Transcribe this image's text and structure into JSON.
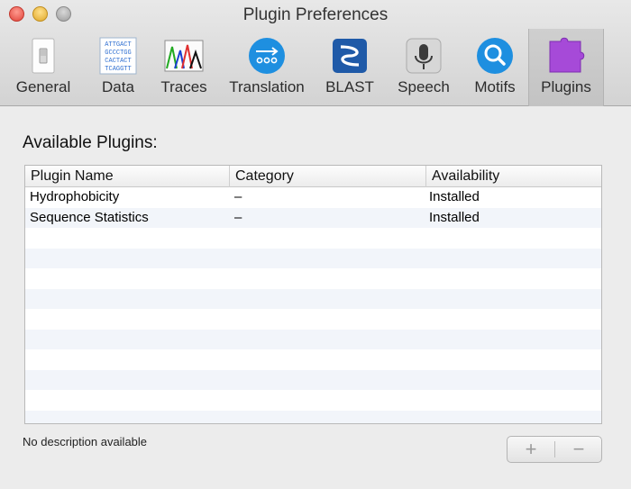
{
  "window": {
    "title": "Plugin Preferences"
  },
  "toolbar": {
    "tabs": [
      {
        "label": "General"
      },
      {
        "label": "Data"
      },
      {
        "label": "Traces"
      },
      {
        "label": "Translation"
      },
      {
        "label": "BLAST"
      },
      {
        "label": "Speech"
      },
      {
        "label": "Motifs"
      },
      {
        "label": "Plugins"
      }
    ],
    "selected": "Plugins",
    "data_icon_text": [
      "ATTGACT",
      "GCCCTGG",
      "CACTACT",
      "TCAGGTT"
    ]
  },
  "main": {
    "section_title": "Available Plugins:",
    "columns": [
      "Plugin Name",
      "Category",
      "Availability"
    ],
    "rows": [
      {
        "name": "Hydrophobicity",
        "category": "–",
        "availability": "Installed"
      },
      {
        "name": "Sequence Statistics",
        "category": "–",
        "availability": "Installed"
      }
    ],
    "description": "No description available",
    "add_label": "+",
    "remove_label": "−"
  },
  "colors": {
    "accent_blue": "#1e8fe0",
    "plugins_purple": "#a64ad8",
    "alt_row": "#f2f5fa"
  }
}
